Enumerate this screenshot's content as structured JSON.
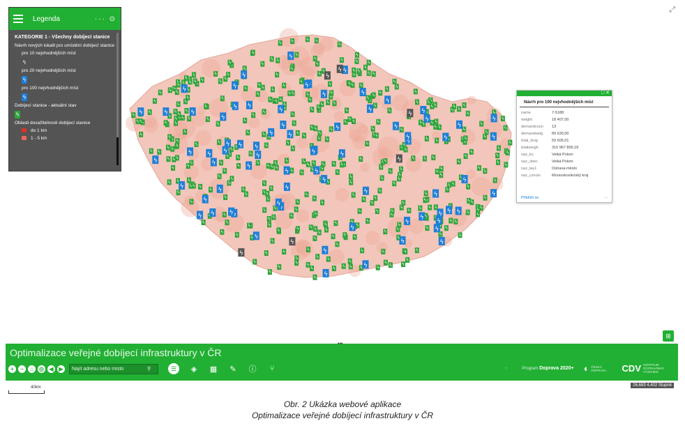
{
  "legend": {
    "title": "Legenda",
    "tools": "··· ⊙",
    "category": "KATEGORIE 1 - Všechny dobíjecí stanice",
    "subtitle": "Návrh nových lokalit pro umístění dobíjecí stanice",
    "items": [
      {
        "label": "pro 10 nejvhodnějších míst",
        "icon": "bolt-icon-white"
      },
      {
        "label": "pro 20 nejvhodnějších míst",
        "icon": "bolt-icon-blue"
      },
      {
        "label": "pro 100 nejvhodnějších míst",
        "icon": "bolt-icon-blue"
      }
    ],
    "current_label": "Dobíjecí stanice - aktuální stav",
    "reach_label": "Oblasti dosažitelnosti dobíjecí stanice",
    "reach_items": [
      {
        "label": "do 1 km",
        "color": "#d9342b"
      },
      {
        "label": "1 - 5 km",
        "color": "#e66a5d"
      }
    ]
  },
  "popup": {
    "title": "Návrh pro 100 nejvhodnějších míst",
    "fields": [
      {
        "key": "name",
        "value": "7-5188"
      },
      {
        "key": "weight",
        "value": "18 407,00"
      },
      {
        "key": "demandcoun",
        "value": "13"
      },
      {
        "key": "demandweig",
        "value": "89 630,00"
      },
      {
        "key": "total_leng",
        "value": "59 605,01"
      },
      {
        "key": "totalweigh",
        "value": "310 967 899,18"
      },
      {
        "key": "naz_ku",
        "value": "Velká Polom"
      },
      {
        "key": "naz_obec",
        "value": "Velká Polom"
      },
      {
        "key": "naz_lau1",
        "value": "Ostrava-město"
      },
      {
        "key": "naz_cznuts",
        "value": "Moravskoslezský kraj"
      }
    ],
    "zoom_link": "Přiblížit se",
    "more": "···"
  },
  "toolbar": {
    "app_title": "Optimalizace veřejné dobíjecí infrastruktury v ČR",
    "search_placeholder": "Najít adresu nebo místo",
    "program_prefix": "Program",
    "program_name": "Doprava 2020+",
    "logo1_text": "ČESKÁ DOPRAVA",
    "logo2_text": "CENTRUM DOPRAVNÍHO VÝZKUMU"
  },
  "footer": {
    "scale": "40km",
    "coords": "26,683 4,402 Stupně"
  },
  "caption": {
    "line1": "Obr. 2  Ukázka webové aplikace",
    "line2": "Optimalizace veřejné dobíjecí infrastruktury v ČR"
  },
  "colors": {
    "accent": "#21b033",
    "marker_green": "#2ea43a",
    "marker_blue": "#1f7fd6",
    "marker_gray": "#555555",
    "map_pink": "#f3c6bb"
  },
  "map_markers": {
    "green_count": 420,
    "blue_count": 75,
    "gray_count": 6
  }
}
